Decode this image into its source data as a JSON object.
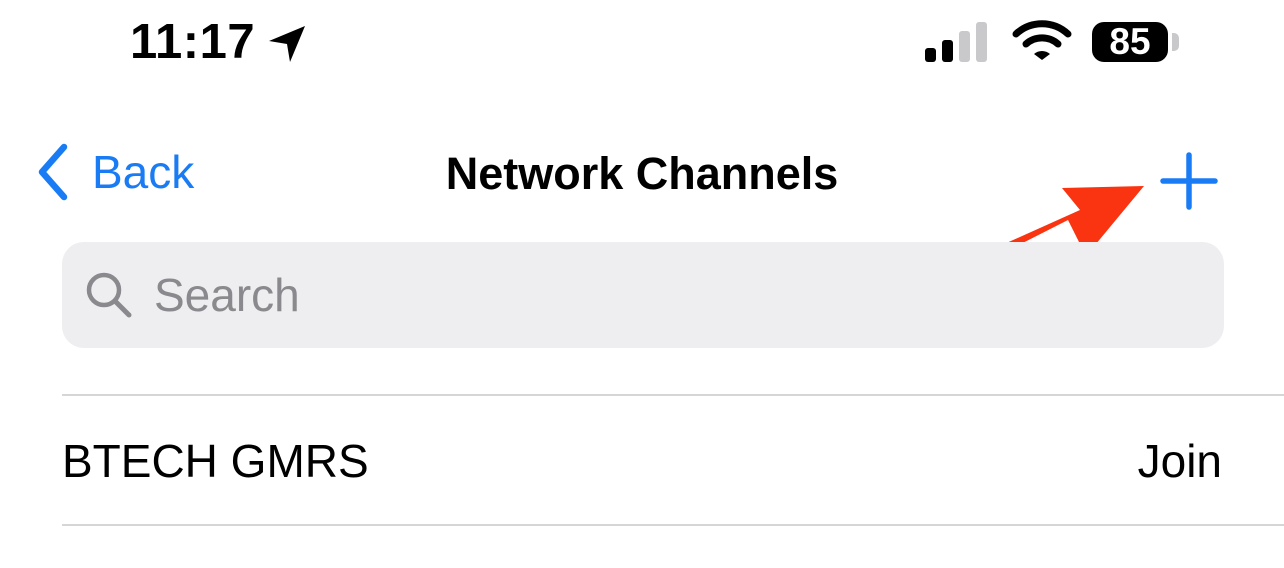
{
  "status_bar": {
    "time": "11:17",
    "battery_level": "85",
    "signal_bars_active": 2,
    "signal_bars_total": 4,
    "icons": [
      "location-arrow-icon",
      "cellular-signal-icon",
      "wifi-icon",
      "battery-icon"
    ]
  },
  "nav": {
    "back_label": "Back",
    "title": "Network Channels",
    "add_icon": "plus-icon",
    "accent_color": "#1a7cf5"
  },
  "annotation": {
    "arrow_color": "#fa3311",
    "points_to": "add-button"
  },
  "search": {
    "placeholder": "Search",
    "value": ""
  },
  "channels": [
    {
      "name": "BTECH GMRS",
      "action": "Join"
    }
  ]
}
